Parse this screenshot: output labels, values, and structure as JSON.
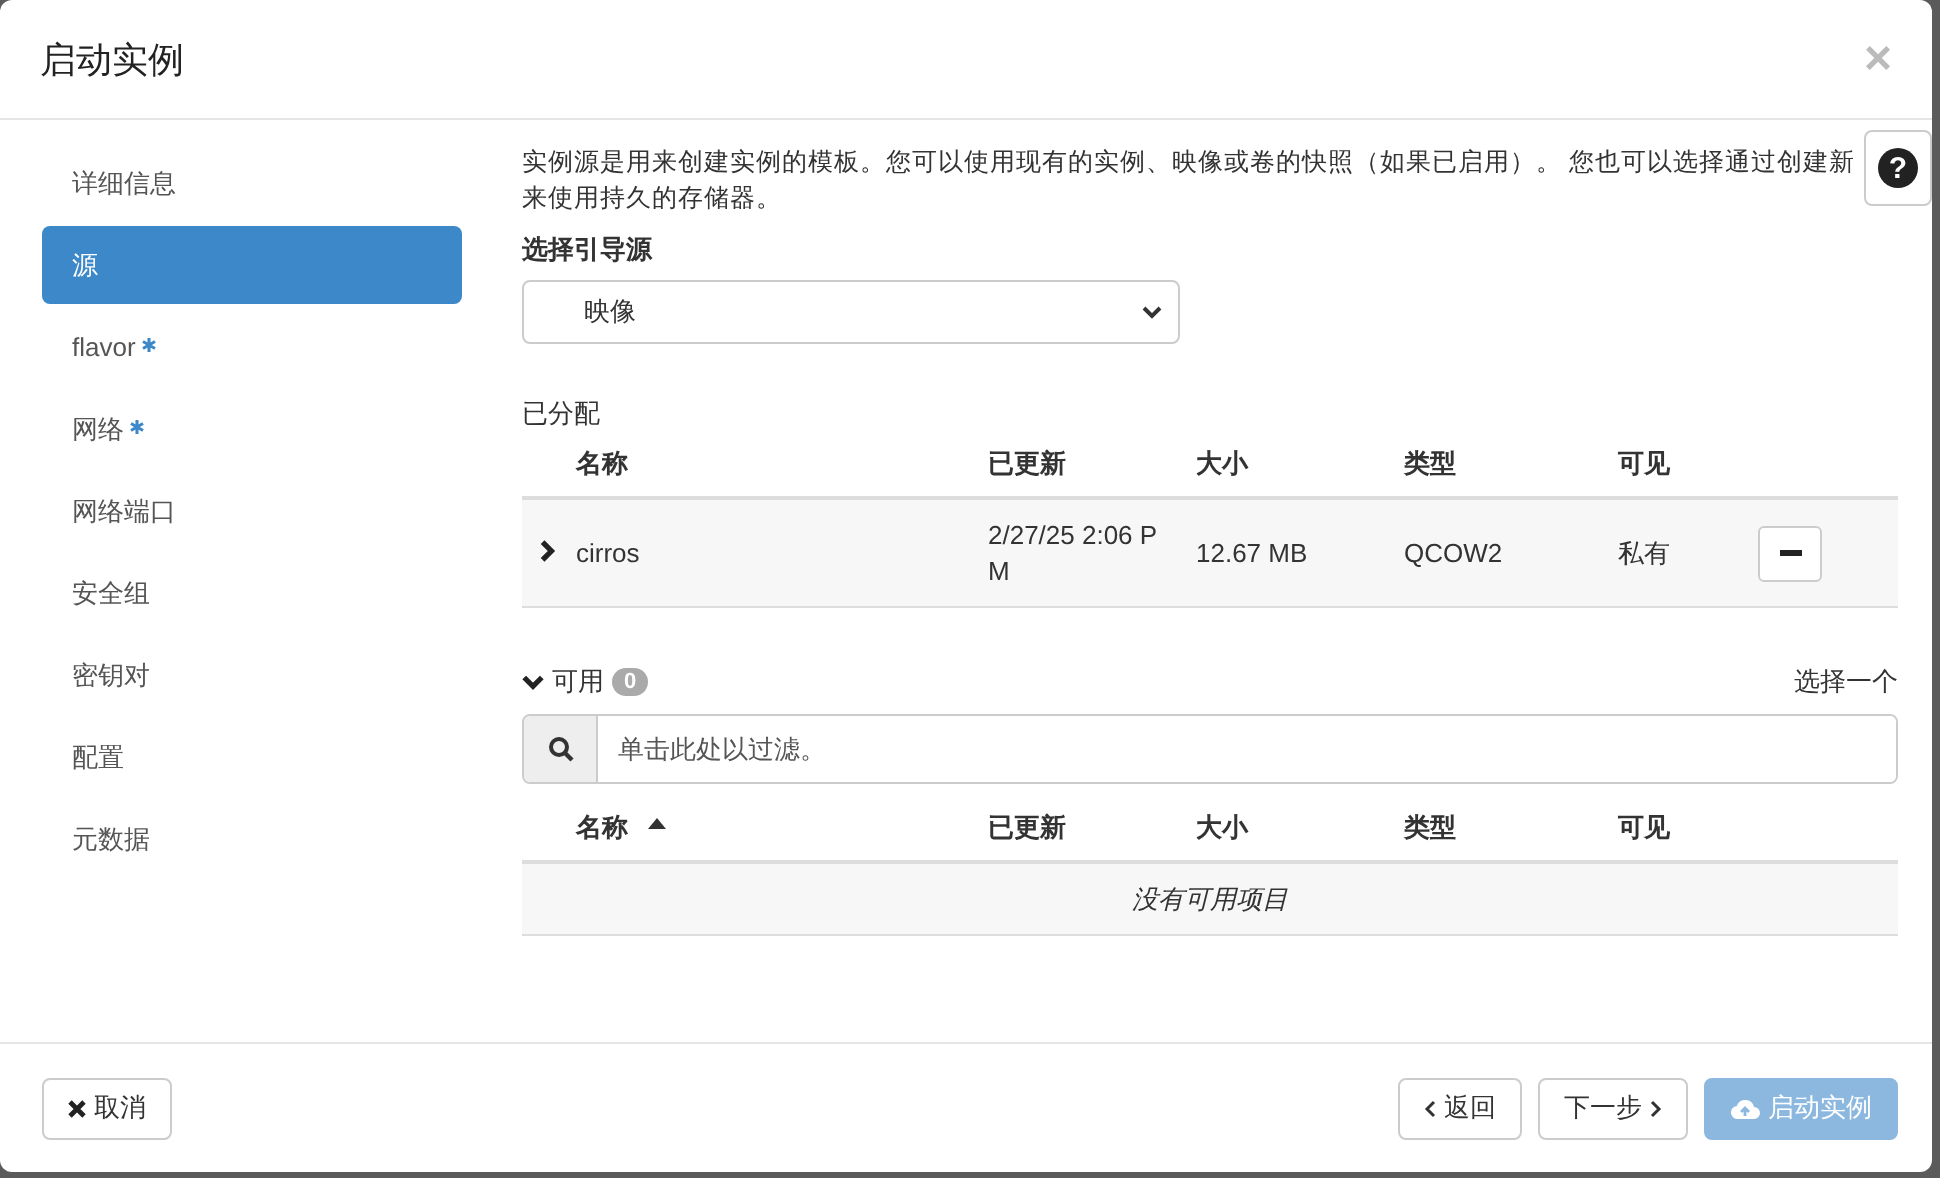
{
  "window": {
    "title": "启动实例",
    "close": "×"
  },
  "sidebar": {
    "items": [
      {
        "label": "详细信息",
        "selected": false,
        "required": false
      },
      {
        "label": "源",
        "selected": true,
        "required": false
      },
      {
        "label": "flavor",
        "selected": false,
        "required": true
      },
      {
        "label": "网络",
        "selected": false,
        "required": true
      },
      {
        "label": "网络端口",
        "selected": false,
        "required": false
      },
      {
        "label": "安全组",
        "selected": false,
        "required": false
      },
      {
        "label": "密钥对",
        "selected": false,
        "required": false
      },
      {
        "label": "配置",
        "selected": false,
        "required": false
      },
      {
        "label": "元数据",
        "selected": false,
        "required": false
      }
    ]
  },
  "help_button": "?",
  "description_lines": [
    "实例源是用来创建实例的模板。您可以使用现有的实例、映像或卷的快照（如果已启用）。 您也可以选择通过创建新",
    "来使用持久的存储器。"
  ],
  "boot_source": {
    "label": "选择引导源",
    "value": "映像"
  },
  "allocated": {
    "title": "已分配",
    "columns": [
      "名称",
      "已更新",
      "大小",
      "类型",
      "可见"
    ],
    "rows": [
      {
        "expanded": false,
        "name": "cirros",
        "updated": "2/27/25 2:06 PM",
        "size": "12.67 MB",
        "type": "QCOW2",
        "visibility": "私有"
      }
    ]
  },
  "available": {
    "title": "可用",
    "expanded": true,
    "count": "0",
    "select_hint": "选择一个",
    "filter": {
      "placeholder": "单击此处以过滤。"
    },
    "columns": [
      {
        "label": "名称",
        "sorted": true
      },
      {
        "label": "已更新",
        "sorted": false
      },
      {
        "label": "大小",
        "sorted": false
      },
      {
        "label": "类型",
        "sorted": false
      },
      {
        "label": "可见",
        "sorted": false
      }
    ],
    "empty_text": "没有可用项目"
  },
  "footer": {
    "cancel": "取消",
    "back": "返回",
    "next": "下一步",
    "launch": "启动实例",
    "launch_disabled": true
  }
}
